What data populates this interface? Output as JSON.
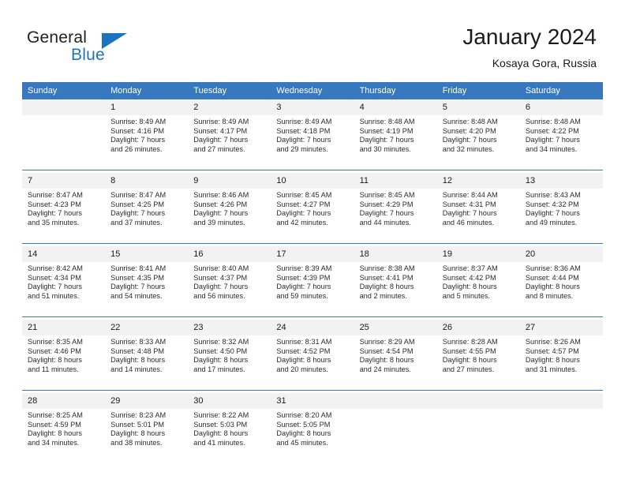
{
  "brand": {
    "name_top": "General",
    "name_bottom": "Blue",
    "triangle_icon": "blue-triangle-icon",
    "accent_color": "#1e73be"
  },
  "header": {
    "title": "January 2024",
    "subtitle": "Kosaya Gora, Russia"
  },
  "calendar": {
    "header_bg": "#3778bf",
    "daynum_bg": "#f2f2f2",
    "weekday_headers": [
      "Sunday",
      "Monday",
      "Tuesday",
      "Wednesday",
      "Thursday",
      "Friday",
      "Saturday"
    ],
    "weeks": [
      [
        {
          "day": "",
          "lines": []
        },
        {
          "day": "1",
          "lines": [
            "Sunrise: 8:49 AM",
            "Sunset: 4:16 PM",
            "Daylight: 7 hours",
            "and 26 minutes."
          ]
        },
        {
          "day": "2",
          "lines": [
            "Sunrise: 8:49 AM",
            "Sunset: 4:17 PM",
            "Daylight: 7 hours",
            "and 27 minutes."
          ]
        },
        {
          "day": "3",
          "lines": [
            "Sunrise: 8:49 AM",
            "Sunset: 4:18 PM",
            "Daylight: 7 hours",
            "and 29 minutes."
          ]
        },
        {
          "day": "4",
          "lines": [
            "Sunrise: 8:48 AM",
            "Sunset: 4:19 PM",
            "Daylight: 7 hours",
            "and 30 minutes."
          ]
        },
        {
          "day": "5",
          "lines": [
            "Sunrise: 8:48 AM",
            "Sunset: 4:20 PM",
            "Daylight: 7 hours",
            "and 32 minutes."
          ]
        },
        {
          "day": "6",
          "lines": [
            "Sunrise: 8:48 AM",
            "Sunset: 4:22 PM",
            "Daylight: 7 hours",
            "and 34 minutes."
          ]
        }
      ],
      [
        {
          "day": "7",
          "lines": [
            "Sunrise: 8:47 AM",
            "Sunset: 4:23 PM",
            "Daylight: 7 hours",
            "and 35 minutes."
          ]
        },
        {
          "day": "8",
          "lines": [
            "Sunrise: 8:47 AM",
            "Sunset: 4:25 PM",
            "Daylight: 7 hours",
            "and 37 minutes."
          ]
        },
        {
          "day": "9",
          "lines": [
            "Sunrise: 8:46 AM",
            "Sunset: 4:26 PM",
            "Daylight: 7 hours",
            "and 39 minutes."
          ]
        },
        {
          "day": "10",
          "lines": [
            "Sunrise: 8:45 AM",
            "Sunset: 4:27 PM",
            "Daylight: 7 hours",
            "and 42 minutes."
          ]
        },
        {
          "day": "11",
          "lines": [
            "Sunrise: 8:45 AM",
            "Sunset: 4:29 PM",
            "Daylight: 7 hours",
            "and 44 minutes."
          ]
        },
        {
          "day": "12",
          "lines": [
            "Sunrise: 8:44 AM",
            "Sunset: 4:31 PM",
            "Daylight: 7 hours",
            "and 46 minutes."
          ]
        },
        {
          "day": "13",
          "lines": [
            "Sunrise: 8:43 AM",
            "Sunset: 4:32 PM",
            "Daylight: 7 hours",
            "and 49 minutes."
          ]
        }
      ],
      [
        {
          "day": "14",
          "lines": [
            "Sunrise: 8:42 AM",
            "Sunset: 4:34 PM",
            "Daylight: 7 hours",
            "and 51 minutes."
          ]
        },
        {
          "day": "15",
          "lines": [
            "Sunrise: 8:41 AM",
            "Sunset: 4:35 PM",
            "Daylight: 7 hours",
            "and 54 minutes."
          ]
        },
        {
          "day": "16",
          "lines": [
            "Sunrise: 8:40 AM",
            "Sunset: 4:37 PM",
            "Daylight: 7 hours",
            "and 56 minutes."
          ]
        },
        {
          "day": "17",
          "lines": [
            "Sunrise: 8:39 AM",
            "Sunset: 4:39 PM",
            "Daylight: 7 hours",
            "and 59 minutes."
          ]
        },
        {
          "day": "18",
          "lines": [
            "Sunrise: 8:38 AM",
            "Sunset: 4:41 PM",
            "Daylight: 8 hours",
            "and 2 minutes."
          ]
        },
        {
          "day": "19",
          "lines": [
            "Sunrise: 8:37 AM",
            "Sunset: 4:42 PM",
            "Daylight: 8 hours",
            "and 5 minutes."
          ]
        },
        {
          "day": "20",
          "lines": [
            "Sunrise: 8:36 AM",
            "Sunset: 4:44 PM",
            "Daylight: 8 hours",
            "and 8 minutes."
          ]
        }
      ],
      [
        {
          "day": "21",
          "lines": [
            "Sunrise: 8:35 AM",
            "Sunset: 4:46 PM",
            "Daylight: 8 hours",
            "and 11 minutes."
          ]
        },
        {
          "day": "22",
          "lines": [
            "Sunrise: 8:33 AM",
            "Sunset: 4:48 PM",
            "Daylight: 8 hours",
            "and 14 minutes."
          ]
        },
        {
          "day": "23",
          "lines": [
            "Sunrise: 8:32 AM",
            "Sunset: 4:50 PM",
            "Daylight: 8 hours",
            "and 17 minutes."
          ]
        },
        {
          "day": "24",
          "lines": [
            "Sunrise: 8:31 AM",
            "Sunset: 4:52 PM",
            "Daylight: 8 hours",
            "and 20 minutes."
          ]
        },
        {
          "day": "25",
          "lines": [
            "Sunrise: 8:29 AM",
            "Sunset: 4:54 PM",
            "Daylight: 8 hours",
            "and 24 minutes."
          ]
        },
        {
          "day": "26",
          "lines": [
            "Sunrise: 8:28 AM",
            "Sunset: 4:55 PM",
            "Daylight: 8 hours",
            "and 27 minutes."
          ]
        },
        {
          "day": "27",
          "lines": [
            "Sunrise: 8:26 AM",
            "Sunset: 4:57 PM",
            "Daylight: 8 hours",
            "and 31 minutes."
          ]
        }
      ],
      [
        {
          "day": "28",
          "lines": [
            "Sunrise: 8:25 AM",
            "Sunset: 4:59 PM",
            "Daylight: 8 hours",
            "and 34 minutes."
          ]
        },
        {
          "day": "29",
          "lines": [
            "Sunrise: 8:23 AM",
            "Sunset: 5:01 PM",
            "Daylight: 8 hours",
            "and 38 minutes."
          ]
        },
        {
          "day": "30",
          "lines": [
            "Sunrise: 8:22 AM",
            "Sunset: 5:03 PM",
            "Daylight: 8 hours",
            "and 41 minutes."
          ]
        },
        {
          "day": "31",
          "lines": [
            "Sunrise: 8:20 AM",
            "Sunset: 5:05 PM",
            "Daylight: 8 hours",
            "and 45 minutes."
          ]
        },
        {
          "day": "",
          "lines": []
        },
        {
          "day": "",
          "lines": []
        },
        {
          "day": "",
          "lines": []
        }
      ]
    ]
  }
}
